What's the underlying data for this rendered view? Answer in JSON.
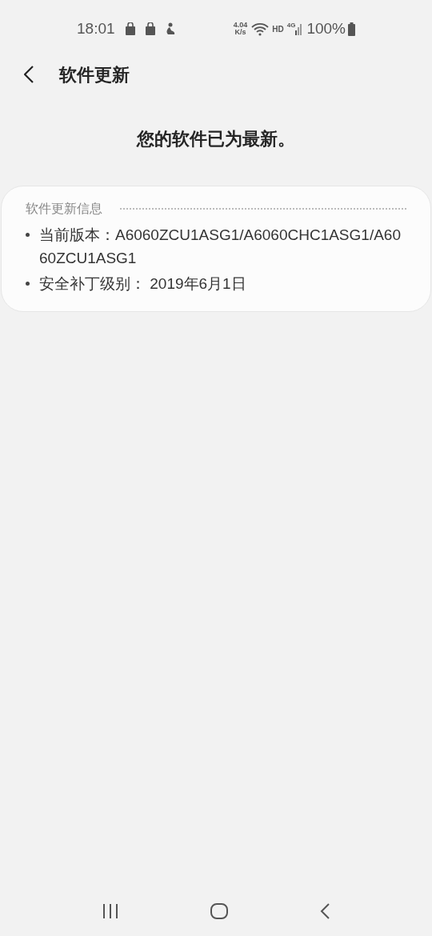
{
  "status_bar": {
    "time": "18:01",
    "speed_value": "4.04",
    "speed_unit": "K/s",
    "hd": "HD",
    "network": "4G",
    "battery": "100%"
  },
  "header": {
    "title": "软件更新"
  },
  "message": "您的软件已为最新。",
  "info_card": {
    "title": "软件更新信息",
    "items": [
      {
        "text": "当前版本：A6060ZCU1ASG1/A6060CHC1ASG1/A6060ZCU1ASG1"
      },
      {
        "text": "安全补丁级别： 2019年6月1日"
      }
    ]
  }
}
